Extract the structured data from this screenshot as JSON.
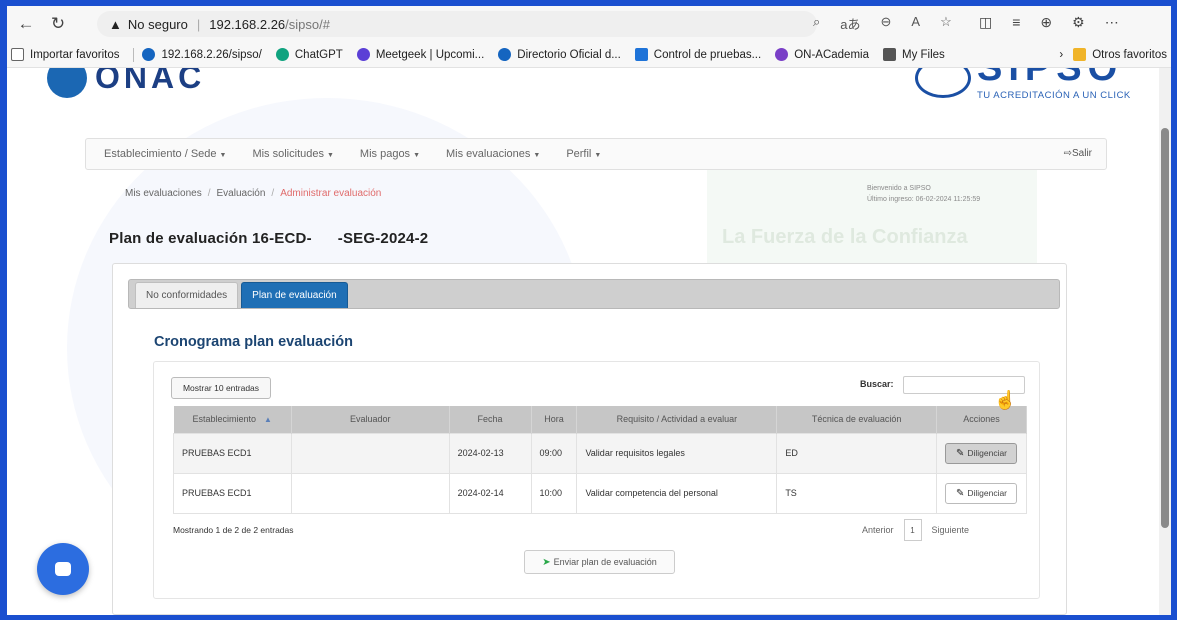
{
  "browser": {
    "security_label": "No seguro",
    "url_host": "192.168.2.26",
    "url_path": "/sipso/#"
  },
  "favorites": [
    {
      "label": "Importar favoritos",
      "color": "#ffffff"
    },
    {
      "label": "192.168.2.26/sipso/",
      "color": "#1565c0"
    },
    {
      "label": "ChatGPT",
      "color": "#10a37f"
    },
    {
      "label": "Meetgeek | Upcomi...",
      "color": "#5b3fd6"
    },
    {
      "label": "Directorio Oficial d...",
      "color": "#1565c0"
    },
    {
      "label": "Control de pruebas...",
      "color": "#1e73d8"
    },
    {
      "label": "ON-ACademia",
      "color": "#7a3fc7"
    },
    {
      "label": "My Files",
      "color": "#555555"
    }
  ],
  "favorites_right": {
    "label": "Otros favoritos"
  },
  "header": {
    "logo_text": "ONAC",
    "sipso_text": "SIPSO",
    "sipso_tagline": "TU ACREDITACIÓN A UN CLICK"
  },
  "menu": {
    "items": [
      "Establecimiento / Sede",
      "Mis solicitudes",
      "Mis pagos",
      "Mis evaluaciones",
      "Perfil"
    ],
    "logout": "Salir"
  },
  "breadcrumb": {
    "items": [
      "Mis evaluaciones",
      "Evaluación"
    ],
    "active": "Administrar evaluación"
  },
  "welcome": {
    "line1": "Bienvenido a SIPSO",
    "line2": "Último ingreso: 06-02-2024 11:25:59"
  },
  "watermark": "La Fuerza de la Confianza",
  "page_title": {
    "part1": "Plan de evaluación 16-ECD-",
    "part2": "-SEG-2024-2"
  },
  "tabs": [
    {
      "label": "No conformidades",
      "active": false
    },
    {
      "label": "Plan de evaluación",
      "active": true
    }
  ],
  "section_title": "Cronograma plan evaluación",
  "table": {
    "show_entries": "Mostrar 10 entradas",
    "search_label": "Buscar:",
    "columns": [
      "Establecimiento",
      "Evaluador",
      "Fecha",
      "Hora",
      "Requisito / Actividad a evaluar",
      "Técnica de evaluación",
      "Acciones"
    ],
    "rows": [
      {
        "establecimiento": "PRUEBAS ECD1",
        "evaluador": "",
        "fecha": "2024-02-13",
        "hora": "09:00",
        "requisito": "Validar requisitos legales",
        "tecnica": "ED",
        "accion": "Diligenciar"
      },
      {
        "establecimiento": "PRUEBAS ECD1",
        "evaluador": "",
        "fecha": "2024-02-14",
        "hora": "10:00",
        "requisito": "Validar competencia del personal",
        "tecnica": "TS",
        "accion": "Diligenciar"
      }
    ],
    "info": "Mostrando 1 de 2 de 2 entradas",
    "pager": {
      "prev": "Anterior",
      "page": "1",
      "next": "Siguiente"
    }
  },
  "send_button": "Enviar plan de evaluación",
  "colors": {
    "brand_blue": "#1f6fb5",
    "frame_blue": "#1a4fcf",
    "title_blue": "#1c4572"
  }
}
